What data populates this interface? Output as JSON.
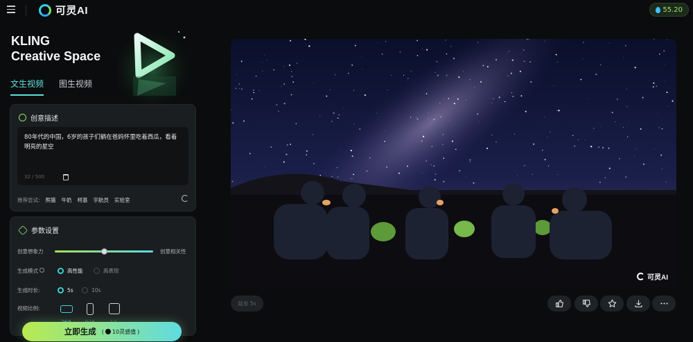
{
  "app": {
    "logo_text": "可灵AI",
    "menu_icon": "menu-icon"
  },
  "credits": {
    "value": "55.20",
    "icon": "drop-icon"
  },
  "brand": {
    "line1": "KLING",
    "line2": "Creative Space"
  },
  "tabs": [
    {
      "label": "文生视频",
      "active": true
    },
    {
      "label": "图生视频",
      "active": false
    }
  ],
  "prompt_card": {
    "title": "创意描述",
    "text": "80年代的中国，6岁的孩子们躺在爸妈怀里吃着西瓜，看着明亮的星空",
    "char_count": "32 / 500",
    "suggest_label": "推荐尝试:",
    "suggestions": [
      "熊猫",
      "牛奶",
      "柯基",
      "宇航员",
      "实验室"
    ]
  },
  "params_card": {
    "title": "参数设置",
    "slider": {
      "left_label": "创意想象力",
      "right_label": "创意相关性",
      "value": 0.5
    },
    "mode": {
      "label": "生成模式",
      "options": [
        {
          "label": "高性能",
          "selected": true
        },
        {
          "label": "高表现",
          "selected": false
        }
      ]
    },
    "duration": {
      "label": "生成时长:",
      "options": [
        {
          "label": "5s",
          "selected": true
        },
        {
          "label": "10s",
          "selected": false
        }
      ]
    },
    "ratio": {
      "label": "视频比例:",
      "options": [
        {
          "label": "16:9",
          "selected": true
        },
        {
          "label": "9:16",
          "selected": false
        },
        {
          "label": "1:1",
          "selected": false
        }
      ]
    }
  },
  "generate": {
    "label": "立即生成",
    "cost": "10灵感值"
  },
  "video": {
    "watermark": "可灵AI"
  },
  "actions": {
    "extend_label": "延长 5s",
    "buttons": [
      "thumbs-up-icon",
      "thumbs-down-icon",
      "star-icon",
      "download-icon",
      "more-icon"
    ]
  },
  "colors": {
    "accent_cyan": "#5fe0e0",
    "accent_green": "#a7e35a",
    "background": "#0b0c0d",
    "card": "#1b1e20"
  }
}
